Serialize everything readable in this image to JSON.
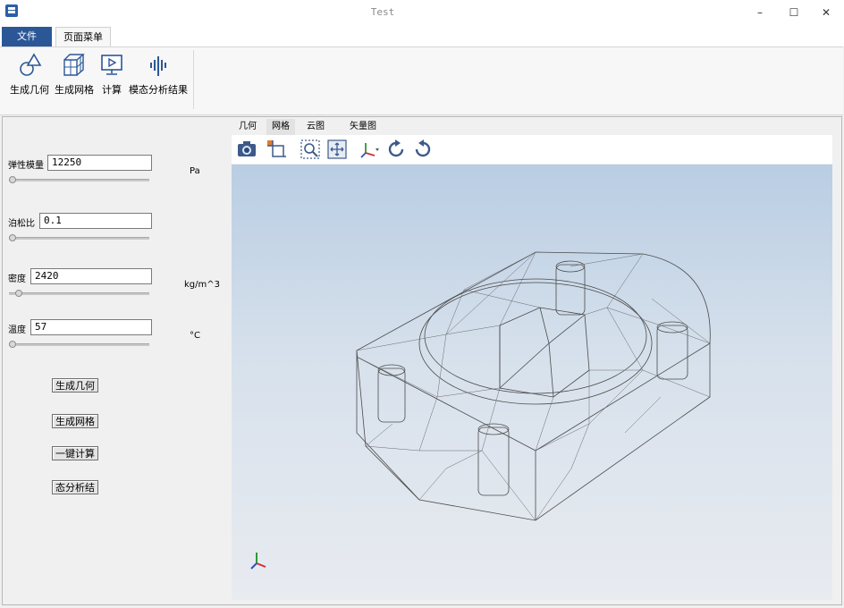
{
  "window": {
    "title": "Test",
    "minimize": "–",
    "maximize": "☐",
    "close": "✕"
  },
  "ribbon": {
    "tabs": [
      "文件",
      "页面菜单"
    ],
    "buttons": [
      {
        "label": "生成几何",
        "icon": "geometry-icon"
      },
      {
        "label": "生成网格",
        "icon": "mesh-cube-icon"
      },
      {
        "label": "计算",
        "icon": "compute-monitor-icon"
      },
      {
        "label": "模态分析结果",
        "icon": "modal-bars-icon"
      }
    ]
  },
  "params": [
    {
      "label": "弹性模量",
      "value": "12250",
      "unit": "Pa",
      "slider": 0.0
    },
    {
      "label": "泊松比",
      "value": "0.1",
      "unit": "",
      "slider": 0.0
    },
    {
      "label": "密度",
      "value": "2420",
      "unit": "kg/m^3",
      "slider": 0.05
    },
    {
      "label": "温度",
      "value": "57",
      "unit": "°C",
      "slider": 0.0
    }
  ],
  "actions": [
    "生成几何",
    "生成网格",
    "一键计算",
    "态分析结"
  ],
  "view_tabs": [
    "几何",
    "网格",
    "云图",
    "矢量图"
  ],
  "toolbar_icons": [
    "camera-icon",
    "projection-icon",
    "zoom-box-icon",
    "fit-view-icon",
    "axes-icon",
    "rotate-cw-icon",
    "rotate-ccw-icon"
  ],
  "colors": {
    "accent": "#2b5797",
    "viewport_top": "#b9cde3",
    "viewport_bottom": "#e8ebf0"
  }
}
